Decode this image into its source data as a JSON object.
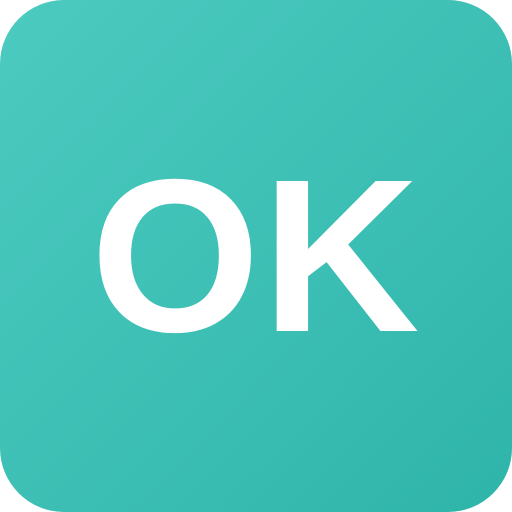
{
  "tile": {
    "label": "OK",
    "colors": {
      "gradient_start": "#4ccbc0",
      "gradient_end": "#2fb4aa",
      "text": "#ffffff"
    }
  }
}
